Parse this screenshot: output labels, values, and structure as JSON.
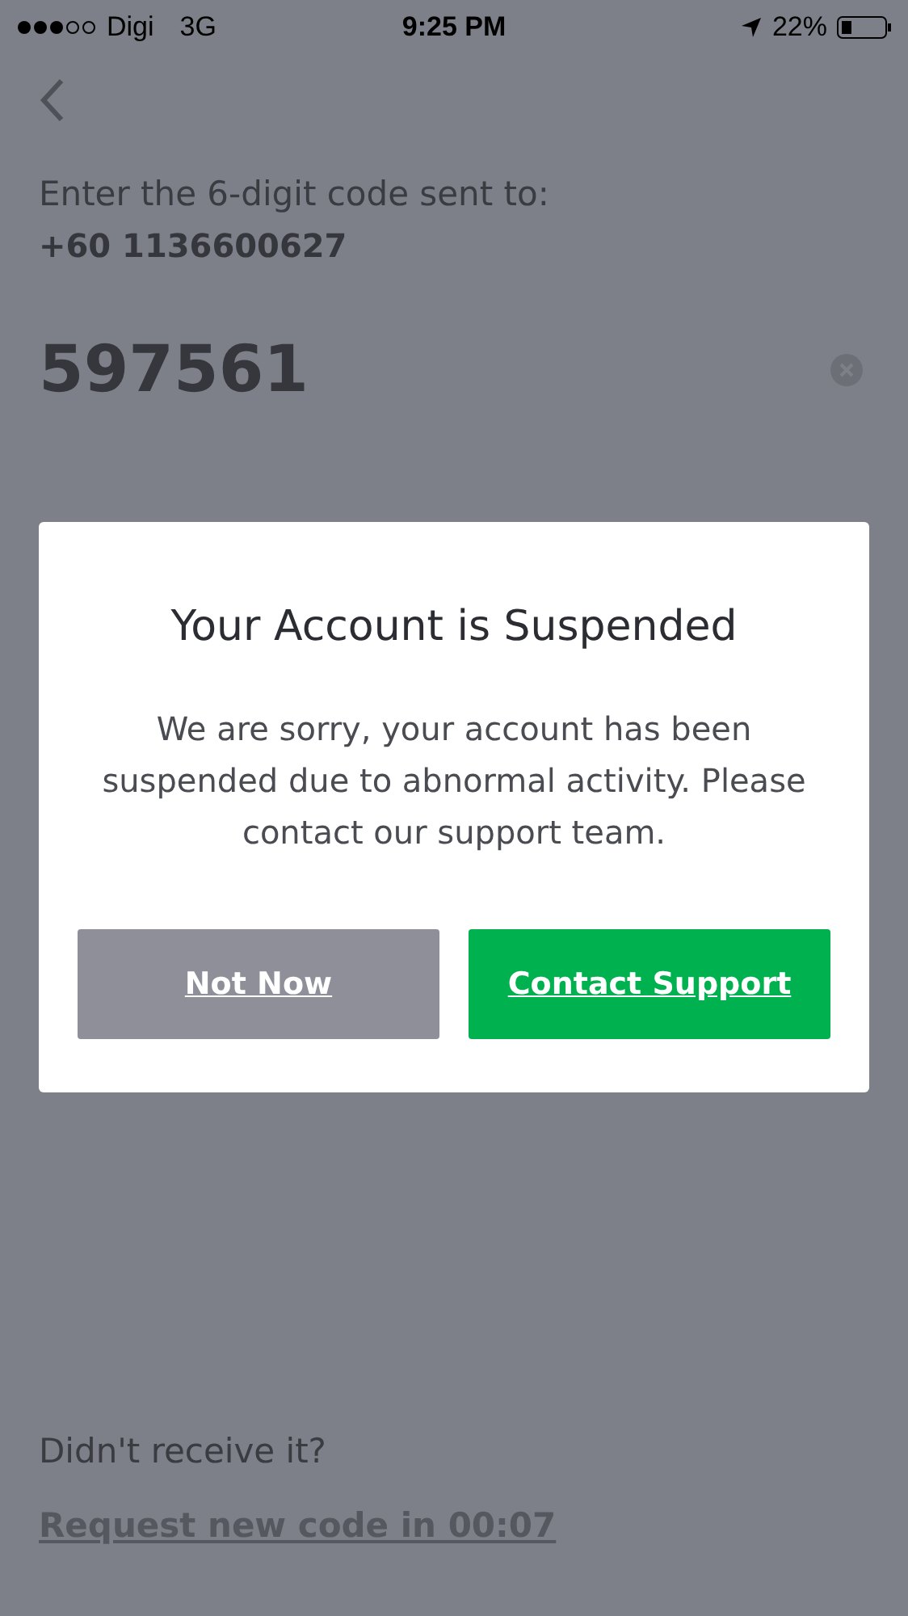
{
  "status_bar": {
    "carrier": "Digi",
    "network": "3G",
    "time": "9:25 PM",
    "battery": "22%"
  },
  "prompt": "Enter the 6-digit code sent to:",
  "phone": "+60 1136600627",
  "code_field": {
    "value": "597561"
  },
  "dialog": {
    "title": "Your Account is Suspended",
    "message": "We are sorry, your account has been suspended due to abnormal activity. Please contact our support team.",
    "buttons": [
      {
        "label": "Not Now",
        "kind": "secondary"
      },
      {
        "label": "Contact Support",
        "kind": "primary"
      }
    ]
  },
  "resend": {
    "question": "Didn't receive it?",
    "link": {
      "label": "Request new code in 00:07",
      "disabled": true
    }
  }
}
